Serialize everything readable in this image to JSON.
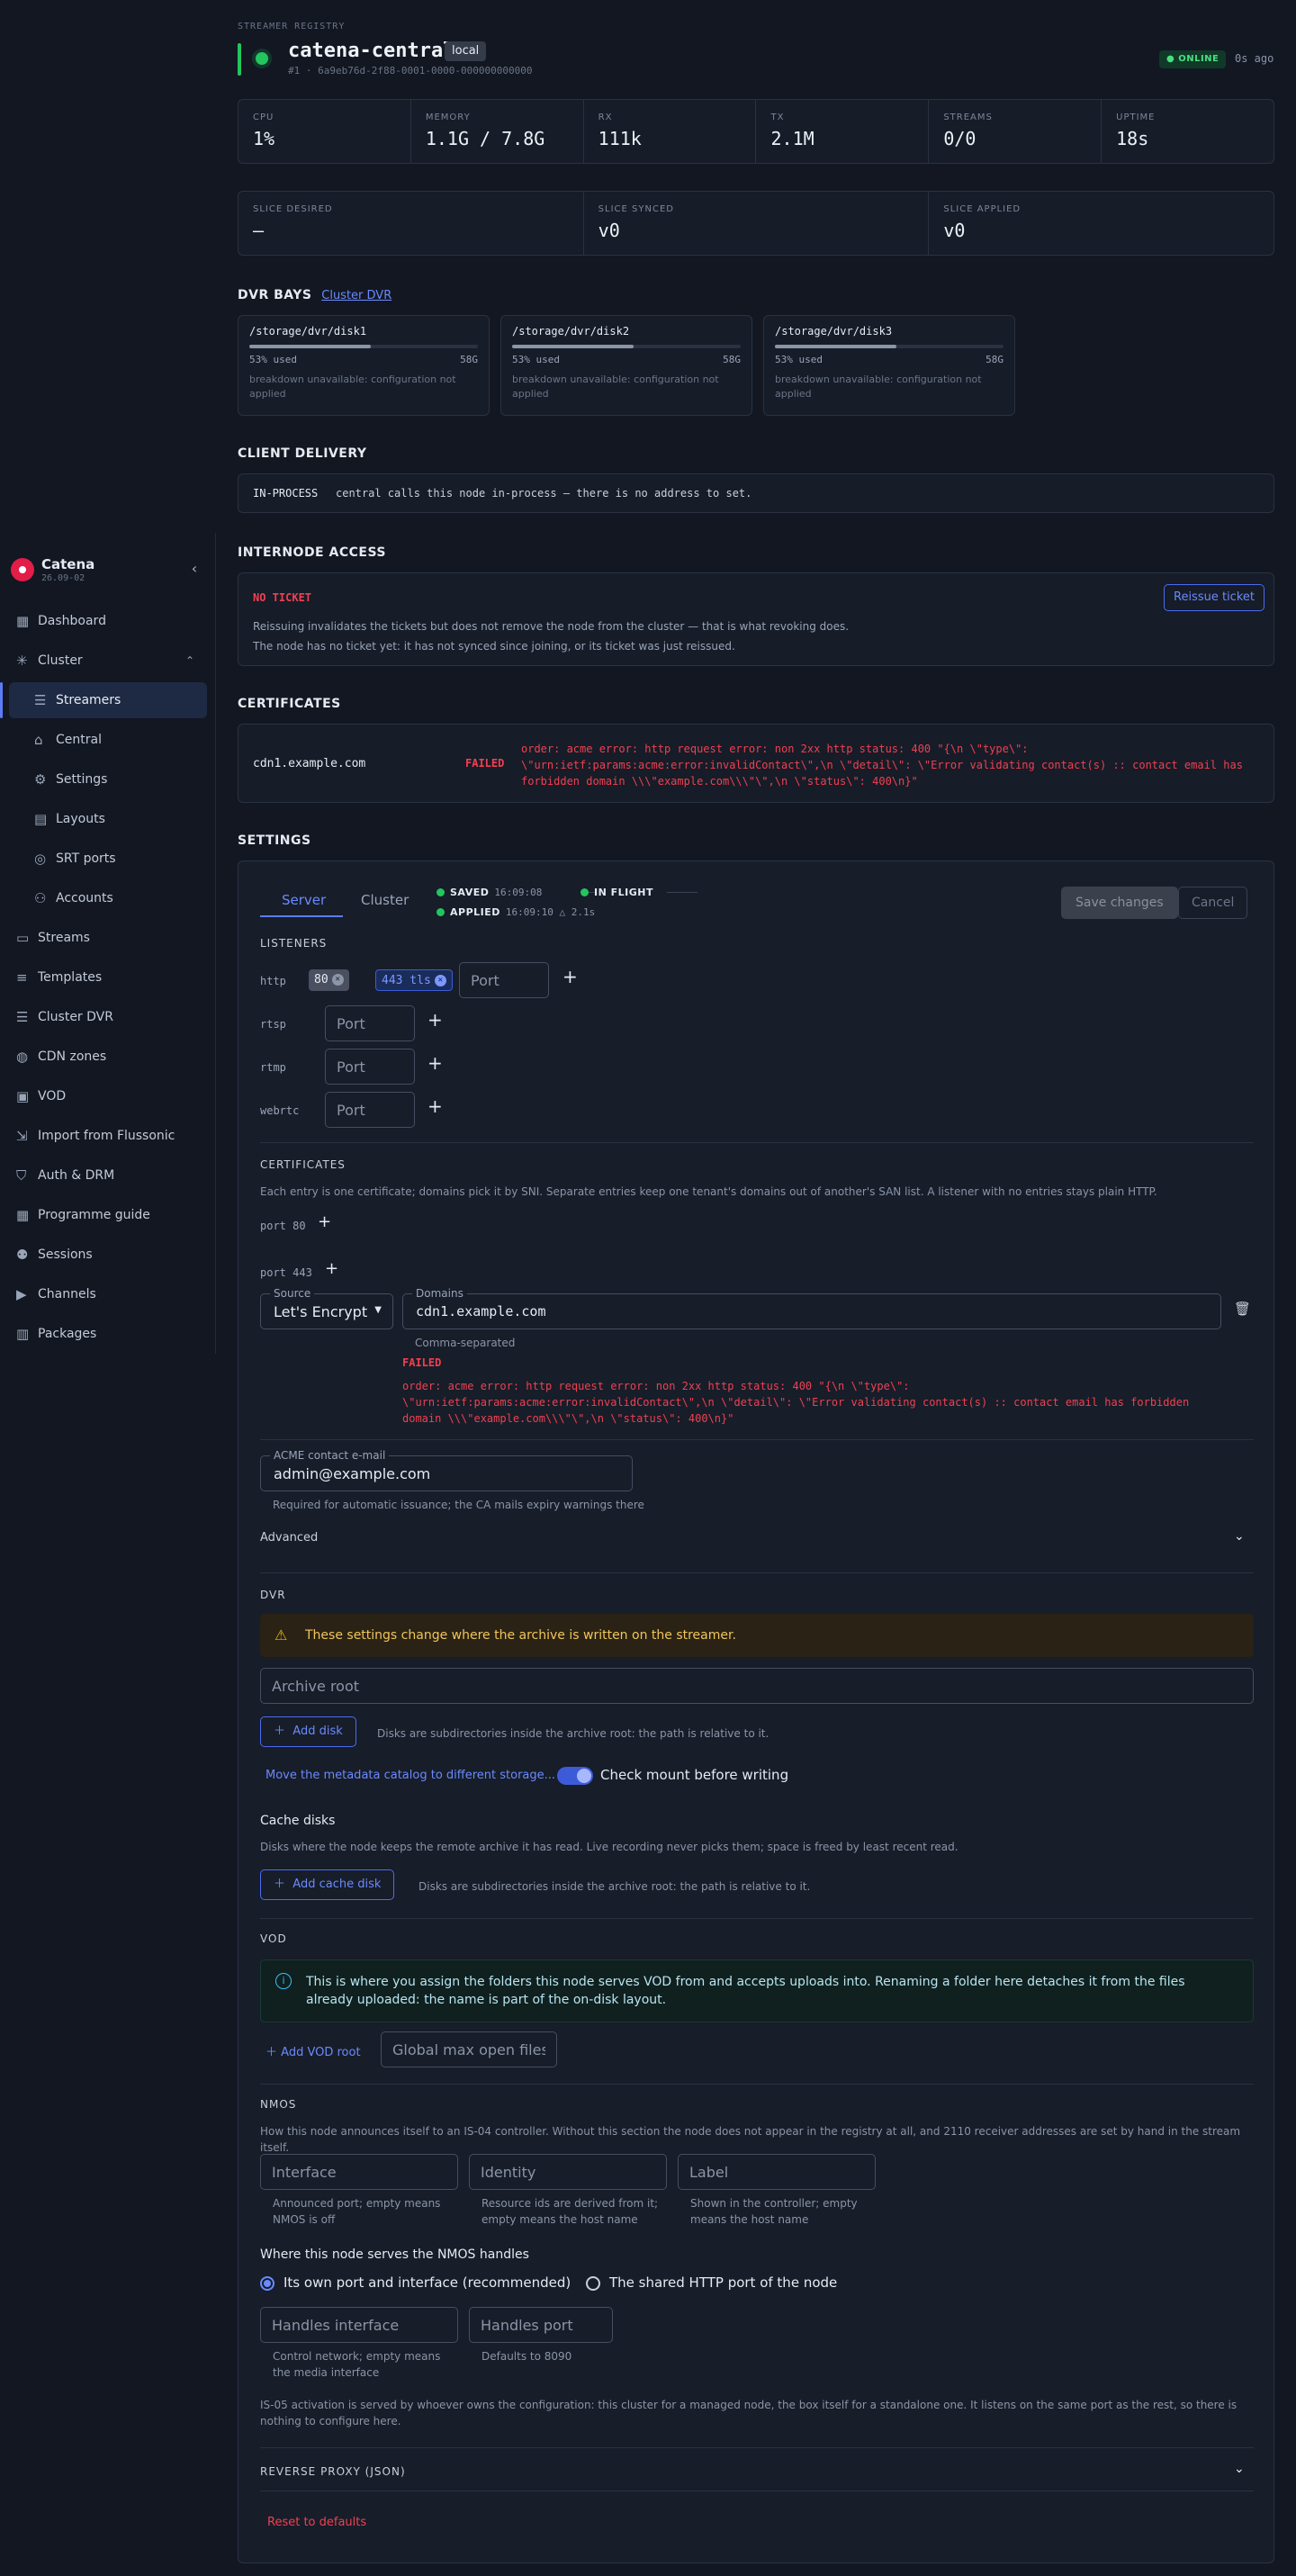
{
  "sidebar": {
    "brand": {
      "name": "Catena",
      "version": "26.09-02"
    },
    "items": [
      {
        "label": "Dashboard",
        "icon": "dashboard-icon"
      },
      {
        "label": "Cluster",
        "icon": "cluster-icon"
      },
      {
        "label": "Streamers",
        "icon": "server-icon"
      },
      {
        "label": "Central",
        "icon": "building-icon"
      },
      {
        "label": "Settings",
        "icon": "gear-icon"
      },
      {
        "label": "Layouts",
        "icon": "layout-icon"
      },
      {
        "label": "SRT ports",
        "icon": "antenna-icon"
      },
      {
        "label": "Accounts",
        "icon": "users-icon"
      },
      {
        "label": "Streams",
        "icon": "monitor-icon"
      },
      {
        "label": "Templates",
        "icon": "sliders-icon"
      },
      {
        "label": "Cluster DVR",
        "icon": "stack-icon"
      },
      {
        "label": "CDN zones",
        "icon": "globe-icon"
      },
      {
        "label": "VOD",
        "icon": "video-file-icon"
      },
      {
        "label": "Import from Flussonic",
        "icon": "import-icon"
      },
      {
        "label": "Auth & DRM",
        "icon": "shield-icon"
      },
      {
        "label": "Programme guide",
        "icon": "calendar-icon"
      },
      {
        "label": "Sessions",
        "icon": "people-icon"
      },
      {
        "label": "Channels",
        "icon": "play-icon"
      },
      {
        "label": "Packages",
        "icon": "package-icon"
      }
    ]
  },
  "header": {
    "eyebrow": "STREAMER REGISTRY",
    "title": "catena-central",
    "tag": "local",
    "node_id": "#1 · 6a9eb76d-2f88-0001-0000-000000000000",
    "status": "● ONLINE",
    "last_seen": "0s ago"
  },
  "stats": [
    {
      "label": "CPU",
      "value": "1%"
    },
    {
      "label": "MEMORY",
      "value": "1.1G / 7.8G"
    },
    {
      "label": "RX",
      "value": "111k"
    },
    {
      "label": "TX",
      "value": "2.1M"
    },
    {
      "label": "STREAMS",
      "value": "0/0"
    },
    {
      "label": "UPTIME",
      "value": "18s"
    }
  ],
  "slices": [
    {
      "label": "SLICE DESIRED",
      "value": "—"
    },
    {
      "label": "SLICE SYNCED",
      "value": "v0"
    },
    {
      "label": "SLICE APPLIED",
      "value": "v0"
    }
  ],
  "dvr_bays": {
    "heading": "DVR BAYS",
    "link": "Cluster DVR",
    "disks": [
      {
        "path": "/storage/dvr/disk1",
        "used_pct": 53,
        "used": "53% used",
        "size": "58G",
        "note": "breakdown unavailable: configuration not applied"
      },
      {
        "path": "/storage/dvr/disk2",
        "used_pct": 53,
        "used": "53% used",
        "size": "58G",
        "note": "breakdown unavailable: configuration not applied"
      },
      {
        "path": "/storage/dvr/disk3",
        "used_pct": 53,
        "used": "53% used",
        "size": "58G",
        "note": "breakdown unavailable: configuration not applied"
      }
    ]
  },
  "client_delivery": {
    "heading": "CLIENT DELIVERY",
    "mode": "IN-PROCESS",
    "text": "central calls this node in-process — there is no address to set."
  },
  "internode": {
    "heading": "INTERNODE ACCESS",
    "status": "NO TICKET",
    "button": "Reissue ticket",
    "line1": "Reissuing invalidates the tickets but does not remove the node from the cluster — that is what revoking does.",
    "line2": "The node has no ticket yet: it has not synced since joining, or its ticket was just reissued."
  },
  "certificates": {
    "heading": "CERTIFICATES",
    "domain": "cdn1.example.com",
    "status": "FAILED",
    "error": "order: acme error: http request error: non 2xx http status: 400 \"{\\n \\\"type\\\": \\\"urn:ietf:params:acme:error:invalidContact\\\",\\n \\\"detail\\\": \\\"Error validating contact(s) :: contact email has forbidden domain \\\\\\\"example.com\\\\\\\"\\\",\\n \\\"status\\\": 400\\n}\""
  },
  "settings": {
    "heading": "SETTINGS",
    "tabs": [
      "Server",
      "Cluster"
    ],
    "saved_label": "SAVED",
    "saved_time": "16:09:08",
    "inflight_label": "IN FLIGHT",
    "applied_label": "APPLIED",
    "applied_time": "16:09:10 △ 2.1s",
    "save_button": "Save changes",
    "cancel_button": "Cancel",
    "listeners": {
      "heading": "LISTENERS",
      "port_placeholder": "Port",
      "rows": [
        {
          "label": "http",
          "chips": [
            "80",
            "443 tls"
          ]
        },
        {
          "label": "rtsp"
        },
        {
          "label": "rtmp"
        },
        {
          "label": "webrtc"
        }
      ]
    },
    "certs": {
      "heading": "CERTIFICATES",
      "help": "Each entry is one certificate; domains pick it by SNI. Separate entries keep one tenant's domains out of another's SAN list. A listener with no entries stays plain HTTP.",
      "port80": "port 80",
      "port443": "port 443",
      "source_legend": "Source",
      "source_value": "Let's Encrypt",
      "domains_legend": "Domains",
      "domains_value": "cdn1.example.com",
      "domains_help": "Comma-separated",
      "failed": "FAILED",
      "error": "order: acme error: http request error: non 2xx http status: 400 \"{\\n \\\"type\\\": \\\"urn:ietf:params:acme:error:invalidContact\\\",\\n \\\"detail\\\": \\\"Error validating contact(s) :: contact email has forbidden domain \\\\\\\"example.com\\\\\\\"\\\",\\n \\\"status\\\": 400\\n}\"",
      "acme_legend": "ACME contact e-mail",
      "acme_value": "admin@example.com",
      "acme_help": "Required for automatic issuance; the CA mails expiry warnings there",
      "advanced": "Advanced"
    },
    "dvr": {
      "heading": "DVR",
      "warning": "These settings change where the archive is written on the streamer.",
      "archive_placeholder": "Archive root",
      "add_disk": "Add disk",
      "disk_help": "Disks are subdirectories inside the archive root: the path is relative to it.",
      "move_catalog": "Move the metadata catalog to different storage...",
      "check_mount": "Check mount before writing",
      "cache_heading": "Cache disks",
      "cache_help": "Disks where the node keeps the remote archive it has read. Live recording never picks them; space is freed by least recent read.",
      "add_cache": "Add cache disk",
      "cache_disk_help": "Disks are subdirectories inside the archive root: the path is relative to it."
    },
    "vod": {
      "heading": "VOD",
      "info": "This is where you assign the folders this node serves VOD from and accepts uploads into. Renaming a folder here detaches it from the files already uploaded: the name is part of the on-disk layout.",
      "add_root": "Add VOD root",
      "max_open_placeholder": "Global max open files"
    },
    "nmos": {
      "heading": "NMOS",
      "help": "How this node announces itself to an IS-04 controller. Without this section the node does not appear in the registry at all, and 2110 receiver addresses are set by hand in the stream itself.",
      "interface_placeholder": "Interface",
      "interface_help": "Announced port; empty means NMOS is off",
      "identity_placeholder": "Identity",
      "identity_help": "Resource ids are derived from it; empty means the host name",
      "label_placeholder": "Label",
      "label_help": "Shown in the controller; empty means the host name",
      "handles_heading": "Where this node serves the NMOS handles",
      "radio_own": "Its own port and interface (recommended)",
      "radio_shared": "The shared HTTP port of the node",
      "handles_iface_placeholder": "Handles interface",
      "handles_iface_help": "Control network; empty means the media interface",
      "handles_port_placeholder": "Handles port",
      "handles_port_help": "Defaults to 8090",
      "is05": "IS-05 activation is served by whoever owns the configuration: this cluster for a managed node, the box itself for a standalone one. It listens on the same port as the rest, so there is nothing to configure here."
    },
    "reverse_proxy": "REVERSE PROXY (JSON)",
    "reset": "Reset to defaults"
  }
}
